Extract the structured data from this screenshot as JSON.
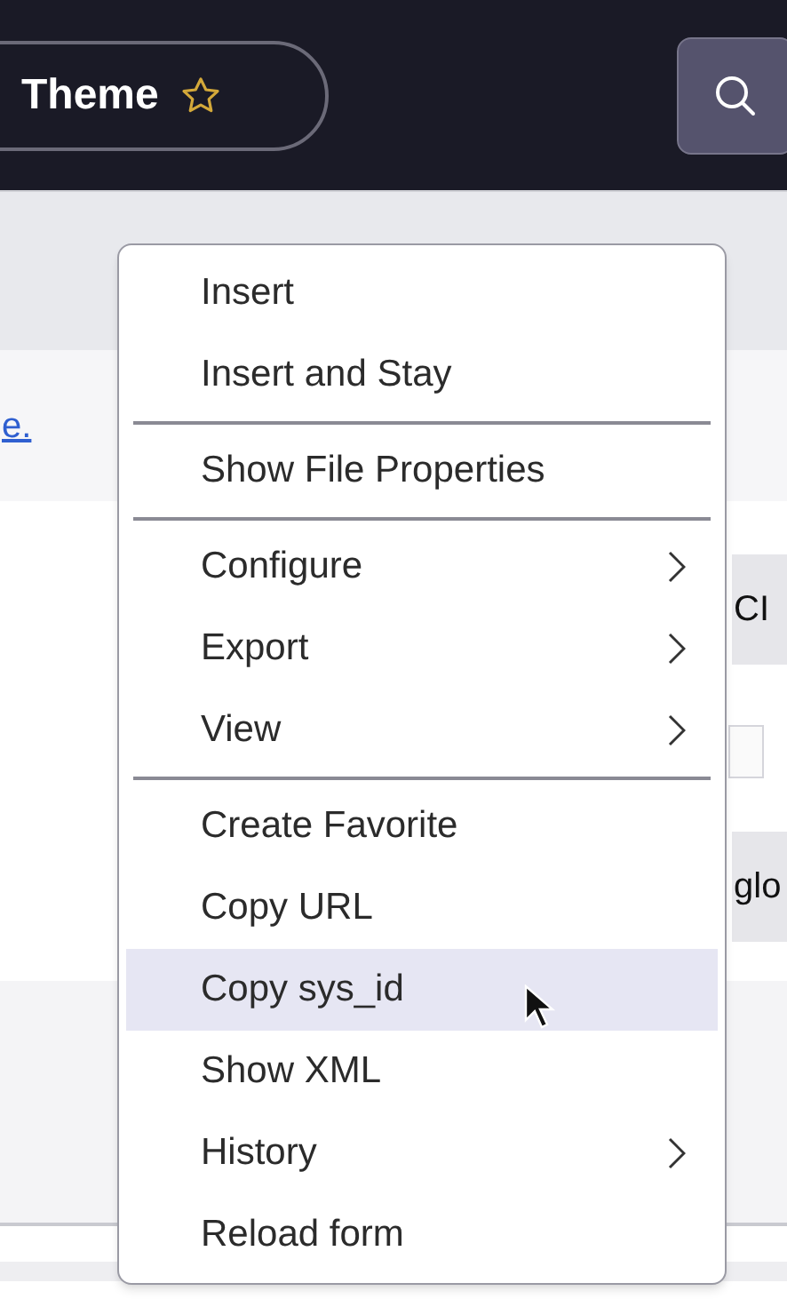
{
  "header": {
    "title": "Theme",
    "favorite": false
  },
  "background": {
    "link_text": "e.",
    "chip_1": "CI",
    "chip_2": "glo",
    "checkbox_checked": false
  },
  "context_menu": {
    "sections": [
      {
        "items": [
          {
            "label": "Insert",
            "submenu": false,
            "selected": false
          },
          {
            "label": "Insert and Stay",
            "submenu": false,
            "selected": false
          }
        ]
      },
      {
        "items": [
          {
            "label": "Show File Properties",
            "submenu": false,
            "selected": false
          }
        ]
      },
      {
        "items": [
          {
            "label": "Configure",
            "submenu": true,
            "selected": false
          },
          {
            "label": "Export",
            "submenu": true,
            "selected": false
          },
          {
            "label": "View",
            "submenu": true,
            "selected": false
          }
        ]
      },
      {
        "items": [
          {
            "label": "Create Favorite",
            "submenu": false,
            "selected": false
          },
          {
            "label": "Copy URL",
            "submenu": false,
            "selected": false
          },
          {
            "label": "Copy sys_id",
            "submenu": false,
            "selected": true
          },
          {
            "label": "Show XML",
            "submenu": false,
            "selected": false
          },
          {
            "label": "History",
            "submenu": true,
            "selected": false
          },
          {
            "label": "Reload form",
            "submenu": false,
            "selected": false
          }
        ]
      }
    ]
  }
}
